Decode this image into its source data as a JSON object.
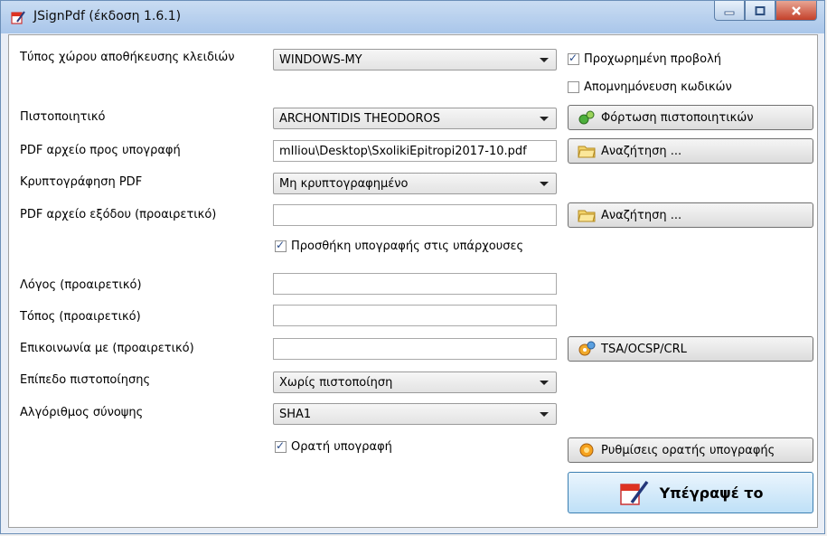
{
  "window": {
    "title": "JSignPdf (έκδοση 1.6.1)"
  },
  "rows": {
    "keystore_type": {
      "label": "Τύπος χώρου αποθήκευσης κλειδιών",
      "value": "WINDOWS-MY"
    },
    "certificate": {
      "label": "Πιστοποιητικό",
      "value": "ARCHONTIDIS THEODOROS"
    },
    "pdf_input": {
      "label": "PDF αρχείο προς υπογραφή",
      "value": "mIliou\\Desktop\\SxolikiEpitropi2017-10.pdf"
    },
    "pdf_encryption": {
      "label": "Κρυπτογράφηση PDF",
      "value": "Μη κρυπτογραφημένο"
    },
    "pdf_output": {
      "label": "PDF αρχείο εξόδου (προαιρετικό)",
      "value": ""
    },
    "reason": {
      "label": "Λόγος (προαιρετικό)",
      "value": ""
    },
    "location": {
      "label": "Τόπος (προαιρετικό)",
      "value": ""
    },
    "contact": {
      "label": "Επικοινωνία με (προαιρετικό)",
      "value": ""
    },
    "cert_level": {
      "label": "Επίπεδο πιστοποίησης",
      "value": "Χωρίς πιστοποίηση"
    },
    "hash_algorithm": {
      "label": "Αλγόριθμος σύνοψης",
      "value": "SHA1"
    }
  },
  "checkboxes": {
    "advanced_view": {
      "label": "Προχωρημένη προβολή",
      "checked": true
    },
    "store_passwords": {
      "label": "Απομνημόνευση κωδικών",
      "checked": false
    },
    "append_signature": {
      "label": "Προσθήκη υπογραφής στις υπάρχουσες",
      "checked": true
    },
    "visible_signature": {
      "label": "Ορατή υπογραφή",
      "checked": true
    }
  },
  "buttons": {
    "load_certs": "Φόρτωση πιστοποιητικών",
    "browse_input": "Αναζήτηση ...",
    "browse_output": "Αναζήτηση ...",
    "tsa": "TSA/OCSP/CRL",
    "visible_settings": "Ρυθμίσεις ορατής υπογραφής",
    "sign": "Υπέγραψέ το"
  },
  "icons": {
    "app": "pdf-pen-icon",
    "load_certs": "gear-chain-icon",
    "browse": "folder-icon",
    "tsa": "cogs-icon",
    "visible_settings": "orange-gear-icon",
    "sign": "pdf-pen-icon"
  }
}
